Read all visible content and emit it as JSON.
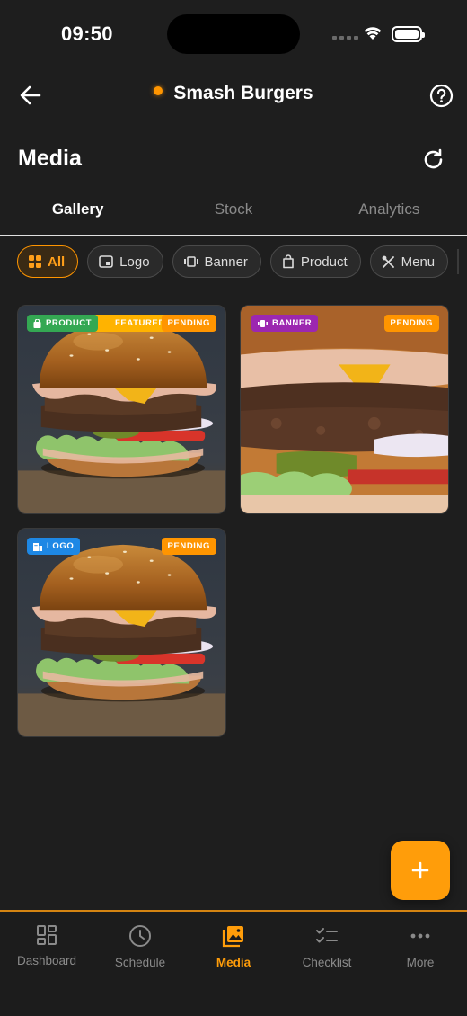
{
  "status_bar": {
    "time": "09:50"
  },
  "header": {
    "title": "Smash Burgers",
    "status_color": "#ff9500",
    "back_icon": "arrow-left-icon",
    "help_icon": "help-circle-icon"
  },
  "section": {
    "title": "Media",
    "refresh_icon": "refresh-icon"
  },
  "tabs": [
    {
      "label": "Gallery",
      "active": true
    },
    {
      "label": "Stock",
      "active": false
    },
    {
      "label": "Analytics",
      "active": false
    }
  ],
  "filters": [
    {
      "label": "All",
      "icon": "grid-icon",
      "active": true
    },
    {
      "label": "Logo",
      "icon": "logo-icon",
      "active": false
    },
    {
      "label": "Banner",
      "icon": "banner-icon",
      "active": false
    },
    {
      "label": "Product",
      "icon": "bag-icon",
      "active": false
    },
    {
      "label": "Menu",
      "icon": "utensils-icon",
      "active": false
    }
  ],
  "media": [
    {
      "type_label": "PRODUCT",
      "featured_label": "FEATURED",
      "status": "PENDING"
    },
    {
      "type_label": "BANNER",
      "status": "PENDING"
    },
    {
      "type_label": "LOGO",
      "status": "PENDING"
    }
  ],
  "fab": {
    "icon": "plus-icon"
  },
  "bottom_nav": [
    {
      "label": "Dashboard",
      "icon": "dashboard-icon",
      "active": false
    },
    {
      "label": "Schedule",
      "icon": "clock-icon",
      "active": false
    },
    {
      "label": "Media",
      "icon": "image-icon",
      "active": true
    },
    {
      "label": "Checklist",
      "icon": "checklist-icon",
      "active": false
    },
    {
      "label": "More",
      "icon": "more-icon",
      "active": false
    }
  ],
  "colors": {
    "accent": "#ff9500",
    "background": "#1e1e1e"
  }
}
